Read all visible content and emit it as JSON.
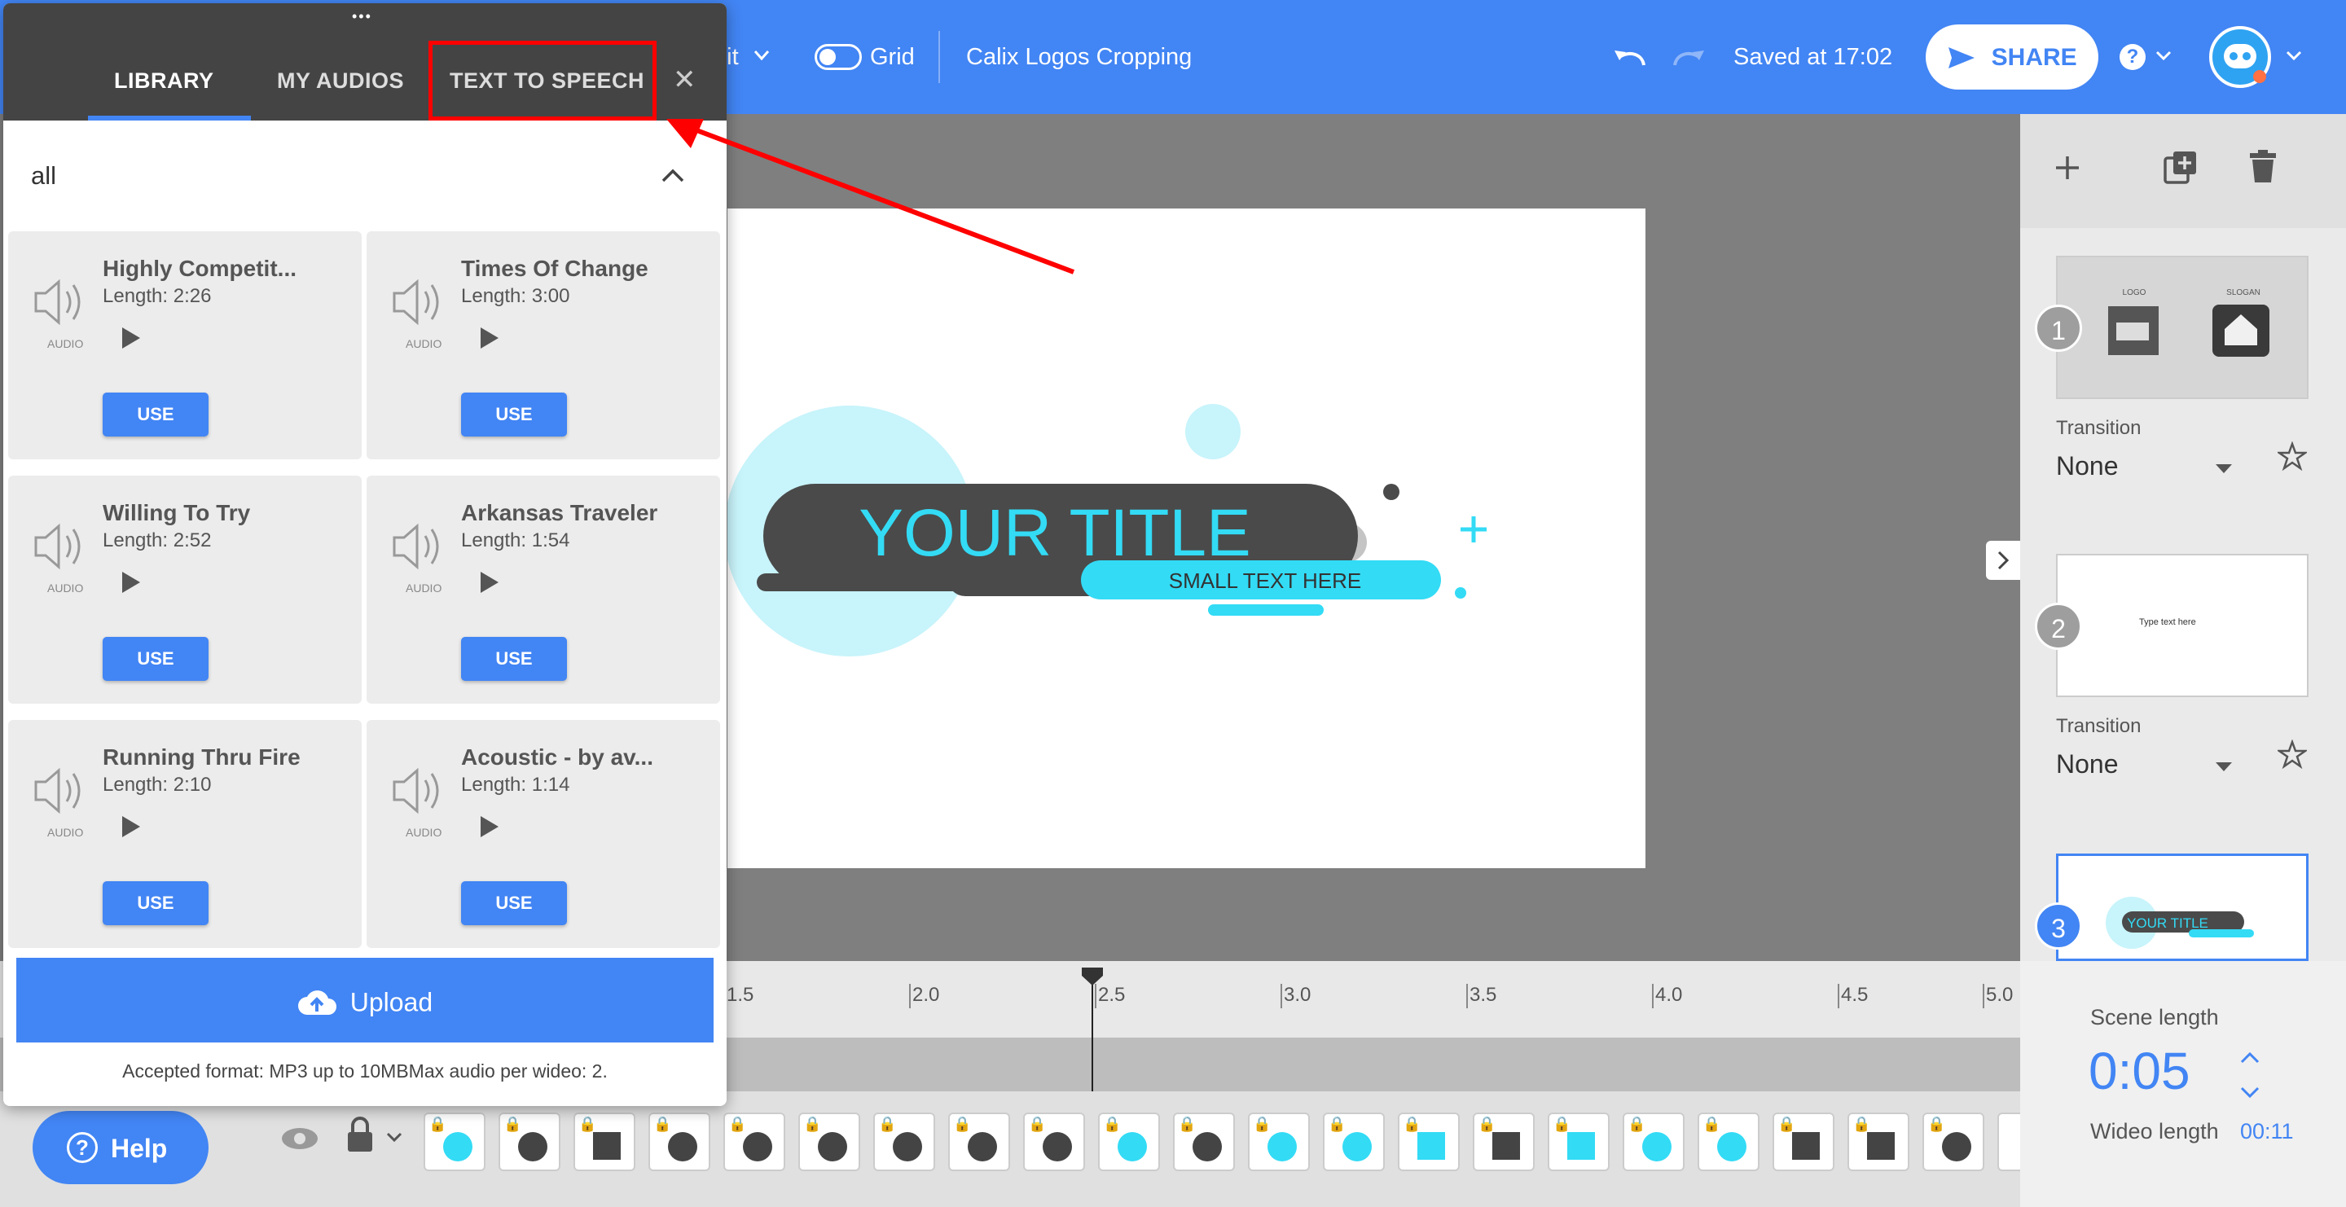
{
  "topbar": {
    "edit_label": "dit",
    "grid_label": "Grid",
    "project_title": "Calix Logos Cropping",
    "saved_text": "Saved at 17:02",
    "share_label": "SHARE",
    "help_symbol": "?"
  },
  "panel": {
    "drag_handle": "•••",
    "tabs": [
      {
        "label": "LIBRARY",
        "active": true
      },
      {
        "label": "MY AUDIOS",
        "active": false
      },
      {
        "label": "TEXT TO SPEECH",
        "active": false
      }
    ],
    "close_symbol": "✕",
    "filter_value": "all",
    "audio_tag": "AUDIO",
    "use_label": "USE",
    "audios": [
      {
        "title": "Highly Competit...",
        "length": "Length: 2:26"
      },
      {
        "title": "Times Of Change",
        "length": "Length: 3:00"
      },
      {
        "title": "Willing To Try",
        "length": "Length: 2:52"
      },
      {
        "title": "Arkansas Traveler",
        "length": "Length: 1:54"
      },
      {
        "title": "Running Thru Fire",
        "length": "Length: 2:10"
      },
      {
        "title": "Acoustic - by av...",
        "length": "Length: 1:14"
      }
    ],
    "upload_label": "Upload",
    "accepted_format": "Accepted format: MP3 up to 10MBMax audio per wideo: 2."
  },
  "canvas": {
    "title": "YOUR TITLE",
    "subtitle": "SMALL TEXT HERE"
  },
  "sidebar": {
    "scenes": [
      {
        "number": "1",
        "transition_label": "Transition",
        "transition_value": "None"
      },
      {
        "number": "2",
        "transition_label": "Transition",
        "transition_value": "None",
        "thumb_text": "Type text here"
      },
      {
        "number": "3",
        "thumb_text": "YOUR TITLE"
      }
    ],
    "thumb1_labels": [
      "LOGO",
      "SLOGAN"
    ]
  },
  "timeline": {
    "ticks": [
      "1.5",
      "2.0",
      "2.5",
      "3.0",
      "3.5",
      "4.0",
      "4.5",
      "5.0"
    ]
  },
  "scene_panel": {
    "scene_length_label": "Scene length",
    "scene_length_value": "0:05",
    "wideo_length_label": "Wideo length",
    "wideo_length_value": "00:11"
  },
  "help_button": {
    "label": "Help",
    "symbol": "?"
  },
  "colors": {
    "brand_blue": "#4285f4",
    "panel_header": "#444444",
    "accent_cyan": "#33dbf5",
    "dark_shape": "#4a4a4a",
    "annotation_red": "#ff0000"
  }
}
